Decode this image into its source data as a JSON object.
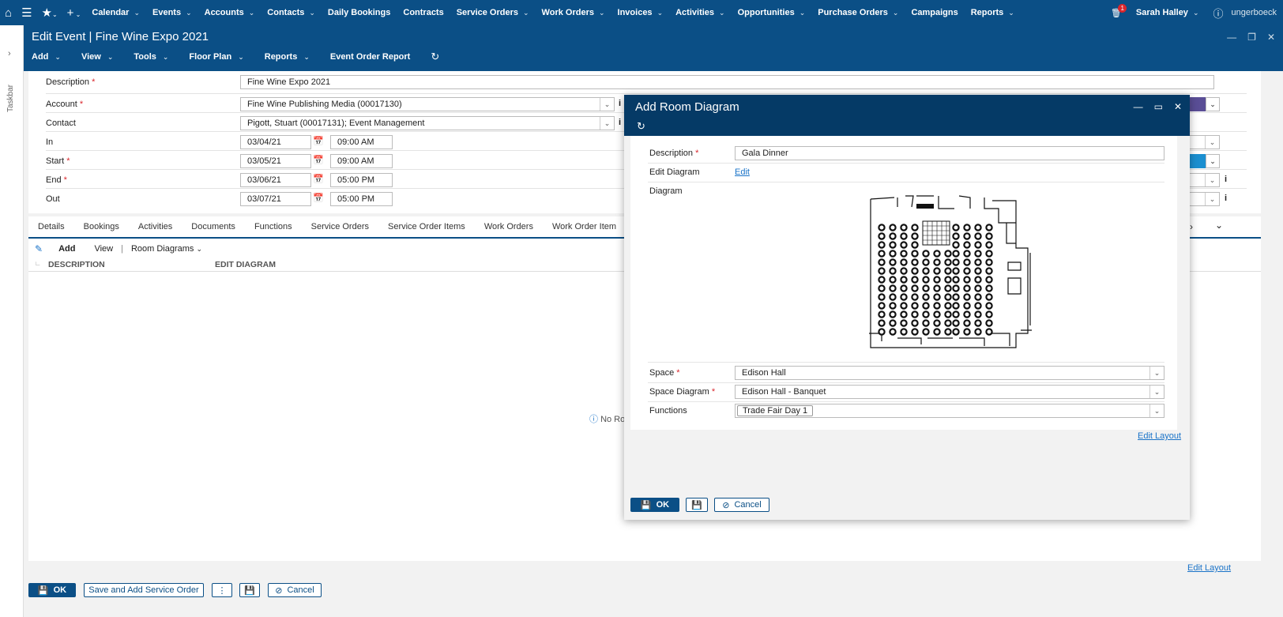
{
  "topnav": {
    "items": [
      {
        "label": "Calendar",
        "chevron": true
      },
      {
        "label": "Events",
        "chevron": true
      },
      {
        "label": "Accounts",
        "chevron": true
      },
      {
        "label": "Contacts",
        "chevron": true
      },
      {
        "label": "Daily Bookings",
        "chevron": false
      },
      {
        "label": "Contracts",
        "chevron": false
      },
      {
        "label": "Service Orders",
        "chevron": true
      },
      {
        "label": "Work Orders",
        "chevron": true
      },
      {
        "label": "Invoices",
        "chevron": true
      },
      {
        "label": "Activities",
        "chevron": true
      },
      {
        "label": "Opportunities",
        "chevron": true
      },
      {
        "label": "Purchase Orders",
        "chevron": true
      },
      {
        "label": "Campaigns",
        "chevron": false
      },
      {
        "label": "Reports",
        "chevron": true
      }
    ],
    "notification_count": "1",
    "user_name": "Sarah Halley",
    "brand": "ungerboeck"
  },
  "taskbar": {
    "label": "Taskbar"
  },
  "window": {
    "title": "Edit Event | Fine Wine Expo 2021",
    "toolbar": [
      "Add",
      "View",
      "Tools",
      "Floor Plan",
      "Reports",
      "Event Order Report"
    ]
  },
  "form": {
    "description_label": "Description",
    "description_value": "Fine Wine Expo 2021",
    "account_label": "Account",
    "account_value": "Fine Wine Publishing Media (00017130)",
    "contact_label": "Contact",
    "contact_value": "Pigott, Stuart (00017131); Event Management",
    "in_label": "In",
    "in_date": "03/04/21",
    "in_time": "09:00 AM",
    "start_label": "Start",
    "start_date": "03/05/21",
    "start_time": "09:00 AM",
    "end_label": "End",
    "end_date": "03/06/21",
    "end_time": "05:00 PM",
    "out_label": "Out",
    "out_date": "03/07/21",
    "out_time": "05:00 PM"
  },
  "tabs": [
    "Details",
    "Bookings",
    "Activities",
    "Documents",
    "Functions",
    "Service Orders",
    "Service Order Items",
    "Work Orders",
    "Work Order Item"
  ],
  "grid": {
    "add_label": "Add",
    "view_label": "View",
    "dropdown_label": "Room Diagrams",
    "col_description": "DESCRIPTION",
    "col_edit_diagram": "EDIT DIAGRAM",
    "empty_text": "No Ro"
  },
  "footer": {
    "ok_label": "OK",
    "save_add_label": "Save and Add Service Order",
    "cancel_label": "Cancel",
    "edit_layout_label": "Edit Layout"
  },
  "modal": {
    "title": "Add Room Diagram",
    "description_label": "Description",
    "description_value": "Gala Dinner",
    "edit_diagram_label": "Edit Diagram",
    "edit_link": "Edit",
    "diagram_label": "Diagram",
    "space_label": "Space",
    "space_value": "Edison Hall",
    "space_diagram_label": "Space Diagram",
    "space_diagram_value": "Edison Hall - Banquet",
    "functions_label": "Functions",
    "functions_value": "Trade Fair Day 1",
    "edit_layout_label": "Edit Layout",
    "ok_label": "OK",
    "cancel_label": "Cancel"
  }
}
